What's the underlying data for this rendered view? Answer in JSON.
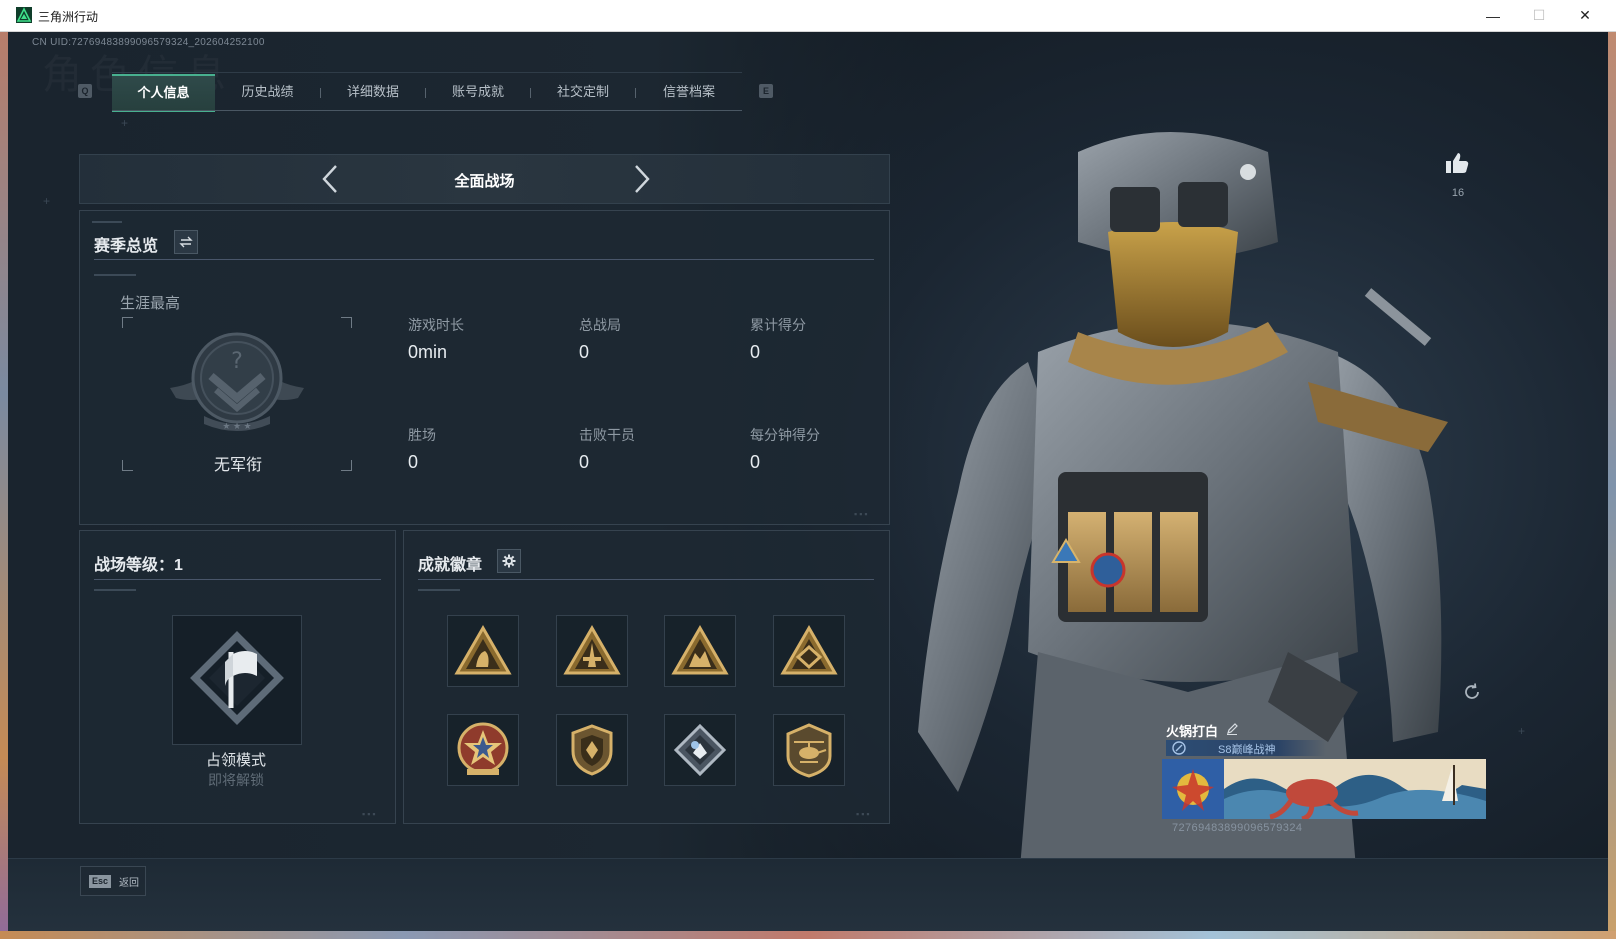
{
  "window": {
    "title": "三角洲行动",
    "minimize": "—",
    "maximize": "☐",
    "close": "✕"
  },
  "uid_header": "CN UID:7276948389909657932​4_202604252100",
  "tabs": [
    {
      "label": "个人信息",
      "active": true
    },
    {
      "label": "历史战绩",
      "active": false
    },
    {
      "label": "详细数据",
      "active": false
    },
    {
      "label": "账号成就",
      "active": false
    },
    {
      "label": "社交定制",
      "active": false
    },
    {
      "label": "信誉档案",
      "active": false
    }
  ],
  "tab_keys": {
    "left": "Q",
    "right": "E"
  },
  "mode": {
    "title": "全面战场"
  },
  "season": {
    "title": "赛季总览",
    "career_label": "生涯最高",
    "rank_name": "无军衔",
    "stats": [
      {
        "label": "游戏时长",
        "value": "0min"
      },
      {
        "label": "总战局",
        "value": "0"
      },
      {
        "label": "累计得分",
        "value": "0"
      },
      {
        "label": "胜场",
        "value": "0"
      },
      {
        "label": "击败干员",
        "value": "0"
      },
      {
        "label": "每分钟得分",
        "value": "0"
      }
    ]
  },
  "level": {
    "title": "战场等级：1",
    "mode_name": "占领模式",
    "mode_status": "即将解锁"
  },
  "badges": {
    "title": "成就徽章"
  },
  "likes": {
    "count": "16"
  },
  "card": {
    "name": "火锅打白",
    "title": "S8巅峰战神",
    "uid": "7276948389909657932​4"
  },
  "esc": {
    "key": "Esc",
    "label": "返回"
  },
  "colors": {
    "accent": "#48b08f",
    "panel": "#1e2933",
    "gold": "#c9a25a"
  }
}
